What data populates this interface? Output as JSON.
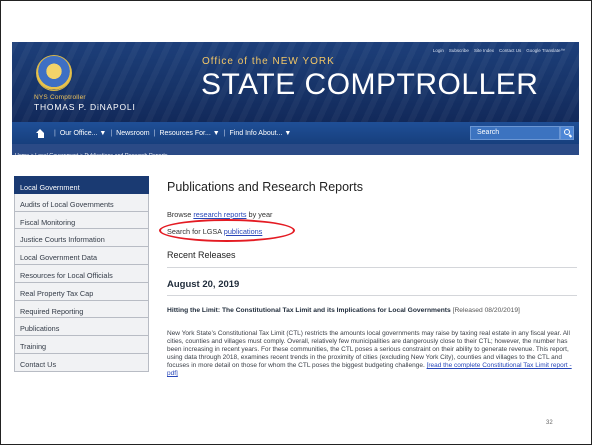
{
  "header": {
    "office_line": "Office of the NEW YORK",
    "office_title": "STATE COMPTROLLER",
    "comptroller_label": "NYS Comptroller",
    "comptroller_name": "THOMAS P. DiNAPOLI",
    "utility_links": [
      "Login",
      "Subscribe",
      "Site Index",
      "Contact Us",
      "Google Translate™"
    ]
  },
  "nav": {
    "items": [
      "Our Office...",
      "Newsroom",
      "Resources For...",
      "Find Info About..."
    ],
    "separator": "|",
    "dropdown_glyph": "▼",
    "search_label": "Search"
  },
  "breadcrumb": "Home > Local Government > Publications and Research Reports",
  "sidebar": {
    "items": [
      "Local Government",
      "Audits of Local Governments",
      "Fiscal Monitoring",
      "Justice Courts Information",
      "Local Government Data",
      "Resources for Local Officials",
      "Real Property Tax Cap",
      "Required Reporting",
      "Publications",
      "Training",
      "Contact Us"
    ]
  },
  "main": {
    "title": "Publications and Research Reports",
    "browse_prefix": "Browse",
    "browse_link": "research reports",
    "browse_suffix": "by year",
    "search_prefix": "Search for LGSA",
    "search_link": "publications",
    "recent_heading": "Recent Releases",
    "date_heading": "August 20, 2019",
    "article_title": "Hitting the Limit: The Constitutional Tax Limit and its Implications for Local Governments",
    "article_released": "[Released 08/20/2019]",
    "article_body": "New York State’s Constitutional Tax Limit (CTL) restricts the amounts local governments may raise by taxing real estate in any fiscal year. All cities, counties and villages must comply. Overall, relatively few municipalities are dangerously close to their CTL; however, the number has been increasing in recent years. For these communities, the CTL poses a serious constraint on their ability to generate revenue. This report, using data through 2018, examines recent trends in the proximity of cities (excluding New York City), counties and villages to the CTL and focuses in more detail on those for whom the CTL poses the biggest budgeting challenge.",
    "article_link": "[read the complete Constitutional Tax Limit report - pdf]"
  },
  "slide": {
    "page_number": "32"
  },
  "colors": {
    "header_blue": "#173469",
    "accent_gold": "#f4c766",
    "link_blue": "#2746b8",
    "highlight_red": "#e41b23",
    "sidebar_active": "#1a3a72"
  }
}
